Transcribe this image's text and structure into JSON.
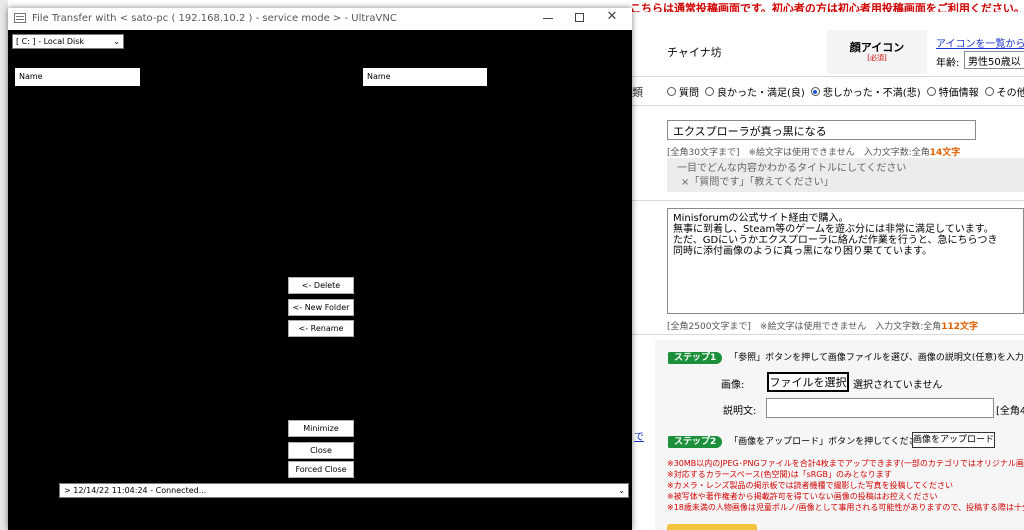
{
  "page": {
    "banner": "こちらは通常投稿画面です。初心者の方は初心者用投稿画面をご利用ください。",
    "author_name": "チャイナ坊",
    "face_icon_label": "顔アイコン",
    "face_icon_required": "[必須]",
    "icon_list_link": "アイコンを一覧から選",
    "age_label": "年齢:",
    "age_value": "男性50歳以",
    "category_label": "類",
    "radios": [
      {
        "label": "質問",
        "checked": false
      },
      {
        "label": "良かった・満足(良)",
        "checked": false
      },
      {
        "label": "悲しかった・不満(悲)",
        "checked": true
      },
      {
        "label": "特価情報",
        "checked": false
      },
      {
        "label": "その他",
        "checked": false
      }
    ],
    "title_value": "エクスプローラが真っ黒になる",
    "title_note": "[全角30文字まで]　※絵文字は使用できません　入力文字数:全角",
    "title_count": "14文字",
    "hint_line1": "一目でどんな内容かわかるタイトルにしてください",
    "hint_line2": "×「質問です」「教えてください」",
    "body_lines": [
      "Minisforumの公式サイト経由で購入。",
      "無事に到着し、Steam等のゲームを遊ぶ分には非常に満足しています。",
      "ただ、GDにいうかエクスプローラに絡んだ作業を行うと、急にちらつき",
      "同時に添付画像のように真っ黒になり困り果てています。"
    ],
    "body_note": "[全角2500文字まで]　※絵文字は使用できません　入力文字数:全角",
    "body_count": "112文字",
    "step1_badge": "ステップ1",
    "step1_text": "「参照」ボタンを押して画像ファイルを選び、画像の説明文(任意)を入力してく",
    "image_label": "画像:",
    "choose_file": "ファイルを選択",
    "no_file": "選択されていません",
    "desc_label": "説明文:",
    "desc_count": "[全角4",
    "step2_badge": "ステップ2",
    "step2_text": "「画像をアップロード」ボタンを押してください。",
    "upload_button": "画像をアップロード",
    "notes": [
      "※30MB以内のJPEG･PNGファイルを合計4枚までアップできます(一部のカテゴリではオリジナル画像を現",
      "※対応するカラースペース(色空間)は「sRGB」のみとなります",
      "※カメラ・レンズ製品の掲示板では読者機種で撮影した写真を投稿してください",
      "※被写体や著作権者から掲載許可を得ていない画像の投稿はお控えください",
      "※18歳未満の人物画像は児童ポルノ/画像として事用される可能性がありますので、投稿する際は十分に"
    ],
    "left_link": "で"
  },
  "vnc": {
    "title": "File Transfer with < sato-pc ( 192.168.10.2 ) - service mode >  -  UltraVNC",
    "drive_select": "[ C: ] - Local Disk",
    "left_header": "Name",
    "right_header": "Name",
    "buttons": {
      "delete": "<- Delete",
      "new_folder": "<- New Folder",
      "rename": "<- Rename",
      "minimize": "Minimize",
      "close": "Close",
      "forced_close": "Forced Close"
    },
    "status": "> 12/14/22 11:04:24 -  Connected..."
  }
}
